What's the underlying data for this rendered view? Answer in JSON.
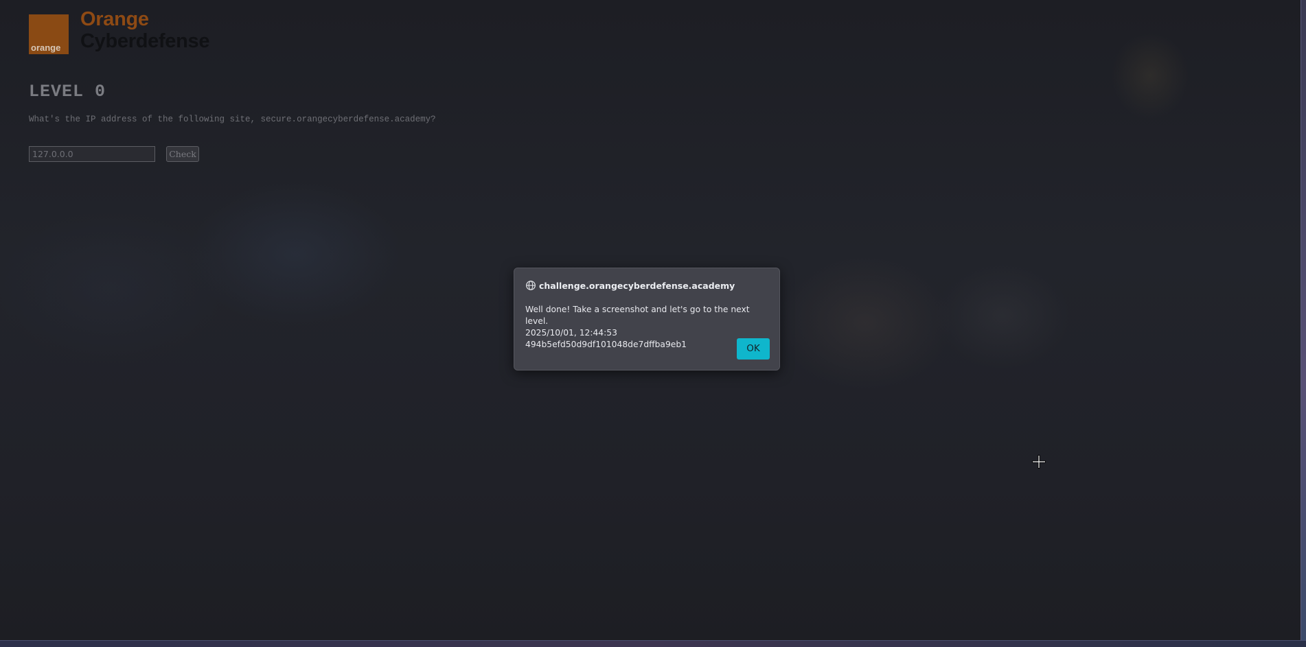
{
  "logo": {
    "box_text": "orange",
    "word_1": "Orange",
    "word_2": "Cyberdefense"
  },
  "challenge": {
    "level_title": "LEVEL 0",
    "question": "What's the IP address of the following site, secure.orangecyberdefense.academy?",
    "answer_value": "127.0.0.0",
    "check_label": "Check"
  },
  "dialog": {
    "origin": "challenge.orangecyberdefense.academy",
    "message": "Well done! Take a screenshot and let's go to the next level.\n2025/10/01, 12:44:53 494b5efd50d9df101048de7dffba9eb1",
    "ok_label": "OK"
  },
  "colors": {
    "brand_orange": "#8e4a14",
    "ok_button": "#0fb6cc",
    "dialog_bg": "#42434b"
  },
  "icons": {
    "dialog_origin": "globe-icon",
    "cursor": "crosshair-move-cursor"
  }
}
